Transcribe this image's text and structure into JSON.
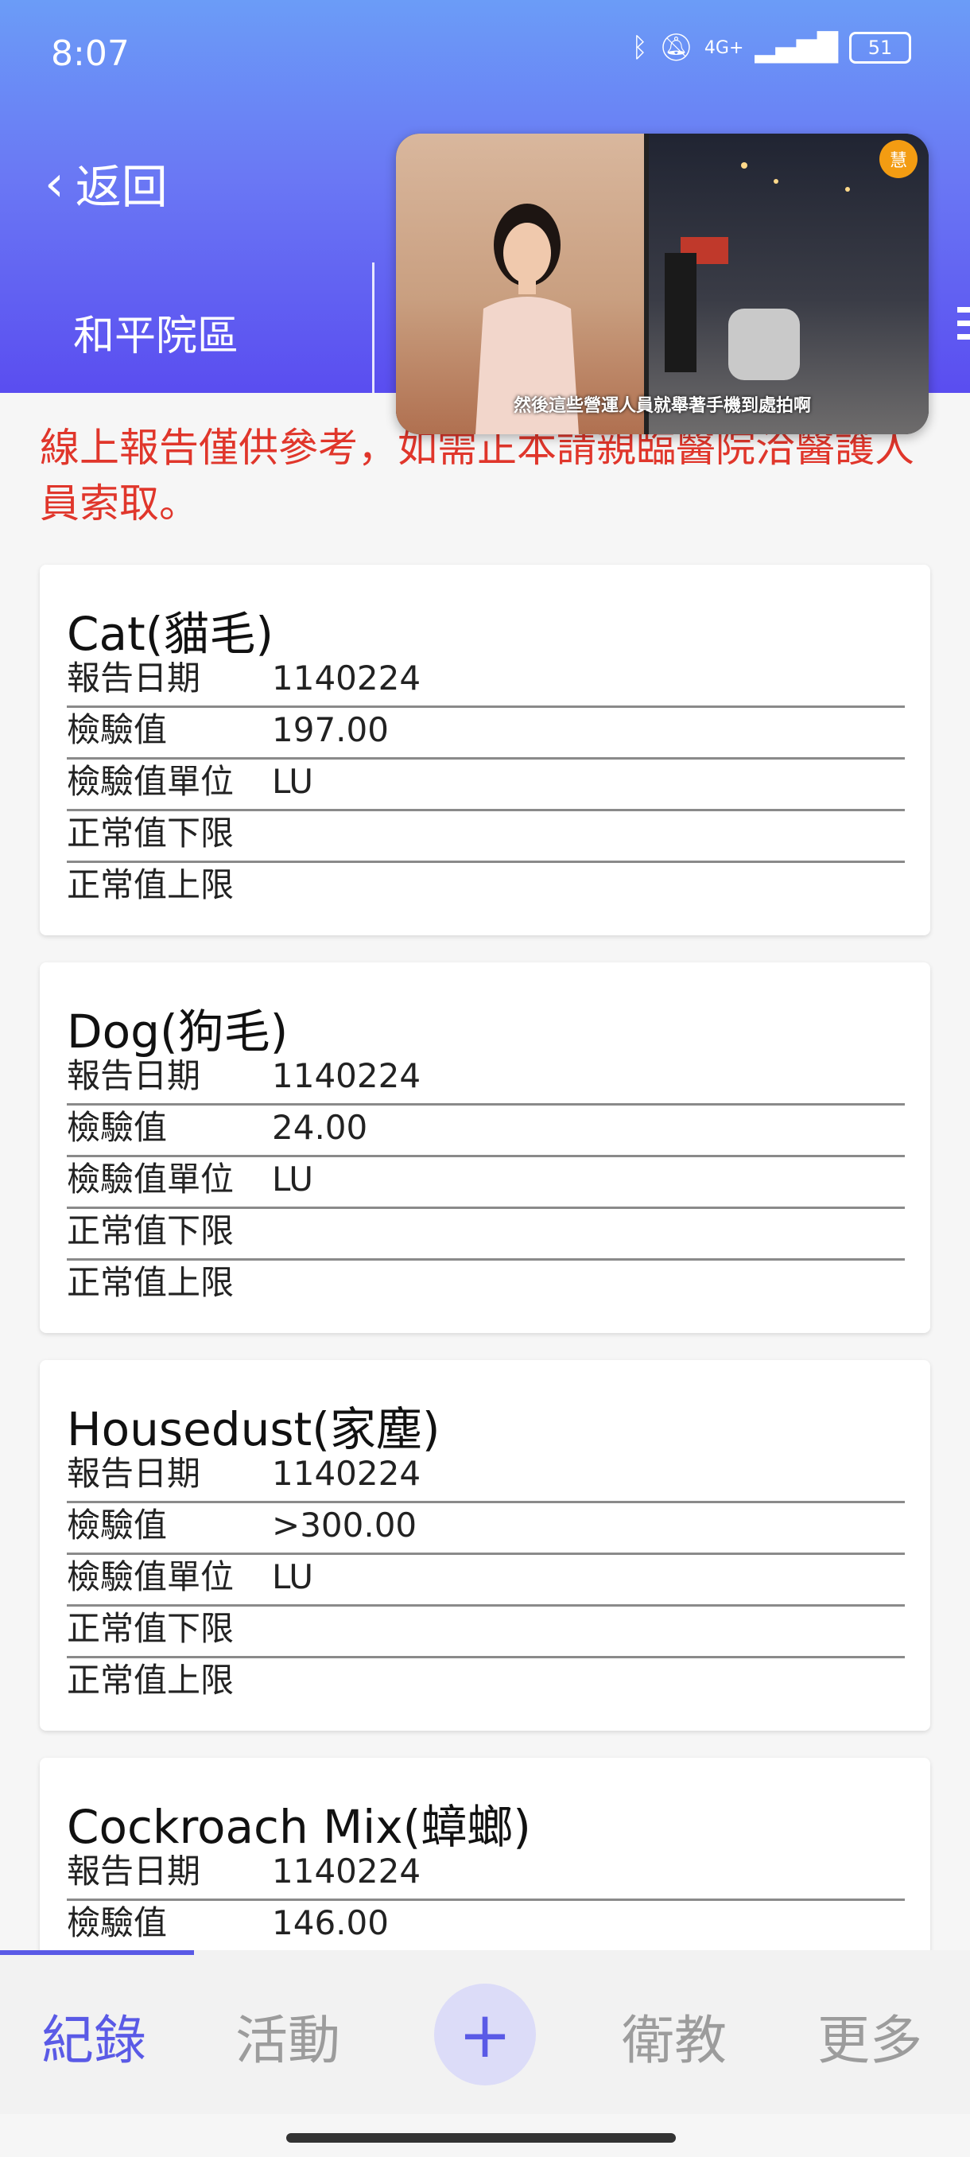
{
  "status": {
    "time": "8:07",
    "battery": "51",
    "network": "4G+"
  },
  "header": {
    "back_label": "返回",
    "campus": "和平院區"
  },
  "video": {
    "caption": "然後這些營運人員就舉著手機到處拍啊",
    "badge": "慧"
  },
  "notice": "線上報告僅供參考，如需正本請親臨醫院洽醫護人員索取。",
  "field_labels": {
    "date": "報告日期",
    "value": "檢驗值",
    "unit": "檢驗值單位",
    "lower": "正常值下限",
    "upper": "正常值上限"
  },
  "cards": [
    {
      "title": "Cat(貓毛)",
      "date": "1140224",
      "value": "197.00",
      "unit": "LU",
      "lower": "",
      "upper": ""
    },
    {
      "title": "Dog(狗毛)",
      "date": "1140224",
      "value": "24.00",
      "unit": "LU",
      "lower": "",
      "upper": ""
    },
    {
      "title": "Housedust(家塵)",
      "date": "1140224",
      "value": ">300.00",
      "unit": "LU",
      "lower": "",
      "upper": ""
    },
    {
      "title": "Cockroach Mix(蟑螂)",
      "date": "1140224",
      "value": "146.00"
    }
  ],
  "tabs": {
    "records": "紀錄",
    "activity": "活動",
    "add": "+",
    "education": "衛教",
    "more": "更多"
  },
  "colors": {
    "accent": "#5a5ae6",
    "notice": "#e0362b"
  }
}
